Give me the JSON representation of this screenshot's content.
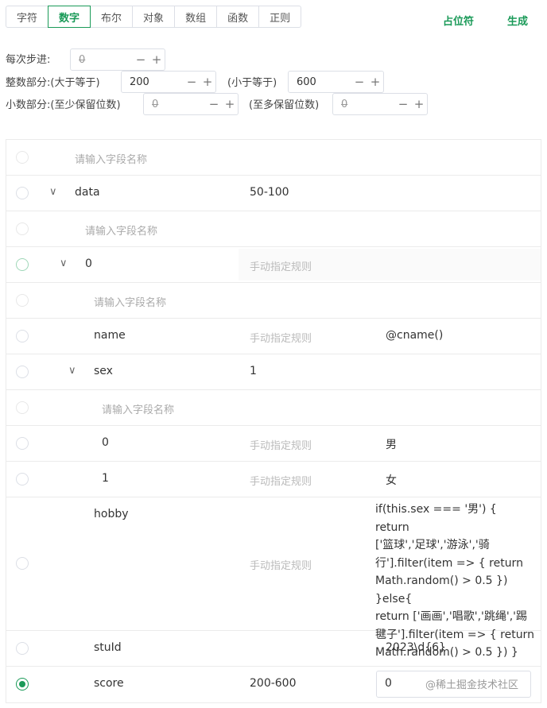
{
  "tabs": [
    {
      "label": "字符"
    },
    {
      "label": "数字",
      "active": true
    },
    {
      "label": "布尔"
    },
    {
      "label": "对象"
    },
    {
      "label": "数组"
    },
    {
      "label": "函数"
    },
    {
      "label": "正则"
    }
  ],
  "actions": {
    "placeholder_label": "占位符",
    "generate_label": "生成"
  },
  "config": {
    "step_label": "每次步进:",
    "step_value": "0",
    "int_label": "整数部分:(大于等于)",
    "int_min": "200",
    "int_max_label": "(小于等于)",
    "int_max": "600",
    "dec_label": "小数部分:(至少保留位数)",
    "dec_min": "0",
    "dec_max_label": "(至多保留位数)",
    "dec_max": "0"
  },
  "tree": {
    "field_placeholder": "请输入字段名称",
    "rule_placeholder": "手动指定规则",
    "rows": [
      {
        "name": "data",
        "rule": "50-100"
      },
      {
        "name": "0"
      },
      {
        "name": "name",
        "value": "@cname()"
      },
      {
        "name": "sex",
        "rule": "1"
      },
      {
        "name": "0",
        "value": "男"
      },
      {
        "name": "1",
        "value": "女"
      },
      {
        "name": "hobby",
        "value_lines": [
          "if(this.sex === '男') { return",
          "['篮球','足球','游泳','骑",
          "行'].filter(item => { return",
          "Math.random() > 0.5 }) }else{",
          "return ['画画','唱歌','跳绳','踢",
          "毽子'].filter(item => { return",
          "Math.random() > 0.5 }) }"
        ]
      },
      {
        "name": "stuId",
        "value": "2023\\d{6}"
      },
      {
        "name": "score",
        "rule": "200-600",
        "value": "0"
      }
    ]
  },
  "watermark": "@稀土掘金技术社区",
  "colors": {
    "accent": "#1a9a58",
    "border": "#ebebeb",
    "placeholder": "#aaaaaa"
  }
}
